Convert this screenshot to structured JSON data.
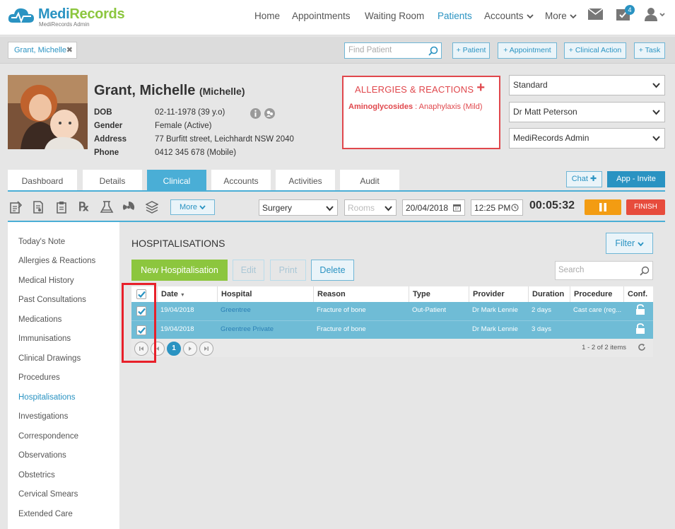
{
  "app": {
    "brand": "MediRecords",
    "brand_sub": "MediRecords Admin"
  },
  "nav": {
    "items": [
      {
        "label": "Home"
      },
      {
        "label": "Appointments"
      },
      {
        "label": "Waiting Room"
      },
      {
        "label": "Patients",
        "active": true
      },
      {
        "label": "Accounts",
        "dropdown": true
      },
      {
        "label": "More",
        "dropdown": true
      }
    ],
    "tasks_badge": "4"
  },
  "toolbar": {
    "patient_tab": "Grant, Michelle",
    "find_placeholder": "Find Patient",
    "buttons": [
      "+ Patient",
      "+ Appointment",
      "+ Clinical Action",
      "+ Task"
    ]
  },
  "patient": {
    "name": "Grant, Michelle",
    "preferred": "(Michelle)",
    "fields": [
      {
        "label": "DOB",
        "value": "02-11-1978 (39 y.o)"
      },
      {
        "label": "Gender",
        "value": "Female (Active)"
      },
      {
        "label": "Address",
        "value": "77 Burfitt street, Leichhardt NSW 2040"
      },
      {
        "label": "Phone",
        "value": "0412 345 678 (Mobile)"
      }
    ]
  },
  "allergies": {
    "title": "ALLERGIES & REACTIONS",
    "add": "+",
    "items": [
      {
        "agent": "Aminoglycosides",
        "reaction": " : Anaphylaxis (Mild)"
      }
    ]
  },
  "selects": [
    "Standard",
    "Dr Matt Peterson",
    "MediRecords Admin"
  ],
  "tabs": [
    {
      "label": "Dashboard"
    },
    {
      "label": "Details"
    },
    {
      "label": "Clinical",
      "active": true
    },
    {
      "label": "Accounts"
    },
    {
      "label": "Activities"
    },
    {
      "label": "Audit"
    }
  ],
  "chat_button": "Chat",
  "app_invite_button": "App - Invite",
  "clinical_toolbar": {
    "more": "More",
    "location": "Surgery",
    "rooms_placeholder": "Rooms",
    "date": "20/04/2018",
    "time": "12:25 PM",
    "timer": "00:05:32",
    "finish": "FINISH",
    "icons": [
      "note-icon",
      "document-icon",
      "clipboard-icon",
      "prescription-icon",
      "lab-icon",
      "radiation-icon",
      "stack-icon"
    ]
  },
  "left_nav": [
    {
      "label": "Today's Note"
    },
    {
      "label": "Allergies & Reactions"
    },
    {
      "label": "Medical History"
    },
    {
      "label": "Past Consultations"
    },
    {
      "label": "Medications"
    },
    {
      "label": "Immunisations"
    },
    {
      "label": "Clinical Drawings"
    },
    {
      "label": "Procedures"
    },
    {
      "label": "Hospitalisations",
      "active": true
    },
    {
      "label": "Investigations"
    },
    {
      "label": "Correspondence"
    },
    {
      "label": "Observations"
    },
    {
      "label": "Obstetrics"
    },
    {
      "label": "Cervical Smears"
    },
    {
      "label": "Extended Care"
    }
  ],
  "hospitalisations": {
    "title": "HOSPITALISATIONS",
    "filter": "Filter",
    "new_button": "New Hospitalisation",
    "edit_button": "Edit",
    "print_button": "Print",
    "delete_button": "Delete",
    "search_placeholder": "Search",
    "columns": [
      "Date",
      "Hospital",
      "Reason",
      "Type",
      "Provider",
      "Duration",
      "Procedure",
      "Conf."
    ],
    "sort_indicator": "▼",
    "rows": [
      {
        "date": "19/04/2018",
        "hospital": "Greentree",
        "reason": "Fracture of bone",
        "type": "Out-Patient",
        "provider": "Dr Mark Lennie",
        "duration": "2 days",
        "procedure": "Cast care (reg...",
        "checked": true
      },
      {
        "date": "19/04/2018",
        "hospital": "Greentree Private",
        "reason": "Fracture of bone",
        "type": "",
        "provider": "Dr Mark Lennie",
        "duration": "3 days",
        "procedure": "",
        "checked": true
      }
    ],
    "pager": {
      "current_page": "1",
      "info": "1 - 2 of 2 items"
    }
  },
  "colors": {
    "accent": "#2a93c2",
    "tab_active": "#4aaed6",
    "row_selected": "#6fbcd6",
    "new_button": "#8cc63e",
    "alert": "#e0474c",
    "pause": "#f39c12",
    "finish": "#e74c3c",
    "highlight": "#e8202a"
  }
}
